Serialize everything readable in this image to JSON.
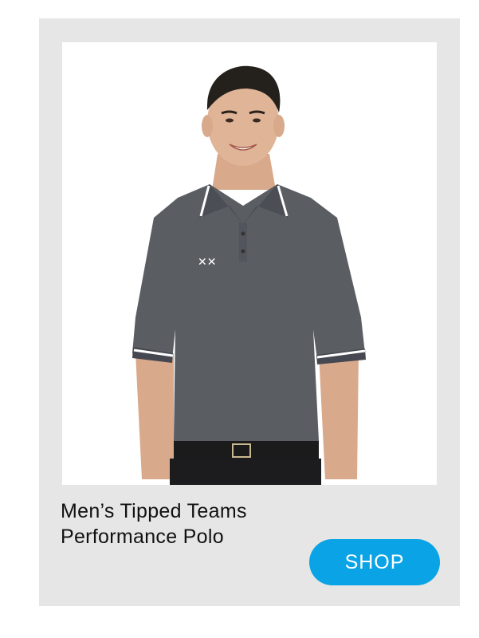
{
  "product": {
    "title_line1": "Men’s Tipped Teams",
    "title_line2": "Performance Polo",
    "image": "man-wearing-gray-polo-shirt"
  },
  "cta": {
    "shop_label": "SHOP"
  },
  "colors": {
    "card_background": "#e6e6e6",
    "button_background": "#0aa4e6",
    "button_text": "#ffffff",
    "shirt": "#5a5d62"
  }
}
